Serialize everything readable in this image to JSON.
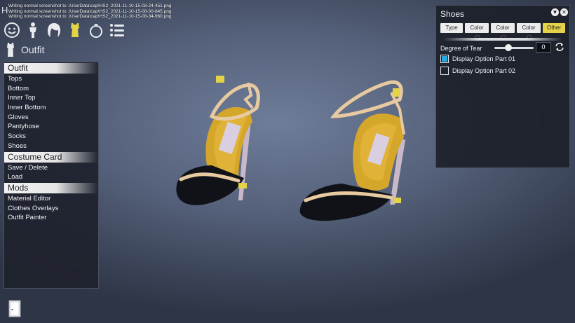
{
  "log_lines": [
    "Writing normal screenshot to .\\UserData\\cap\\HS2_2021-11-10-15-08-24-451.png",
    "Writing normal screenshot to .\\UserData\\cap\\HS2_2021-11-10-15-08-30-845.png",
    "Writing normal screenshot to .\\UserData\\cap\\HS2_2021-11-10-15-08-34-960.png"
  ],
  "corner_letter": "H",
  "top_icons": [
    "face-icon",
    "body-icon",
    "hair-icon",
    "outfit-icon",
    "accessory-icon",
    "list-icon"
  ],
  "header": {
    "title": "Outfit"
  },
  "menu": {
    "outfit": {
      "title": "Outfit",
      "items": [
        "Tops",
        "Bottom",
        "Inner Top",
        "Inner Bottom",
        "Gloves",
        "Pantyhose",
        "Socks",
        "Shoes"
      ]
    },
    "costume_card": {
      "title": "Costume Card",
      "items": [
        "Save / Delete",
        "Load"
      ]
    },
    "mods": {
      "title": "Mods",
      "items": [
        "Material Editor",
        "Clothes Overlays",
        "Outfit Painter"
      ]
    }
  },
  "shoes_panel": {
    "title": "Shoes",
    "tabs": [
      {
        "label": "Type",
        "num": ""
      },
      {
        "label": "Color",
        "num": "1"
      },
      {
        "label": "Color",
        "num": "2"
      },
      {
        "label": "Color",
        "num": "3"
      },
      {
        "label": "Other",
        "num": ""
      }
    ],
    "active_tab": "Other",
    "tear_label": "Degree of Tear",
    "tear_value": "0",
    "tear_fraction": 0.35,
    "options": [
      {
        "label": "Display Option Part 01",
        "checked": true
      },
      {
        "label": "Display Option Part 02",
        "checked": false
      }
    ]
  },
  "colors": {
    "accent_yellow": "#e4d248",
    "checkbox_blue": "#26a9e0",
    "panel_bg": "#1c202a"
  }
}
